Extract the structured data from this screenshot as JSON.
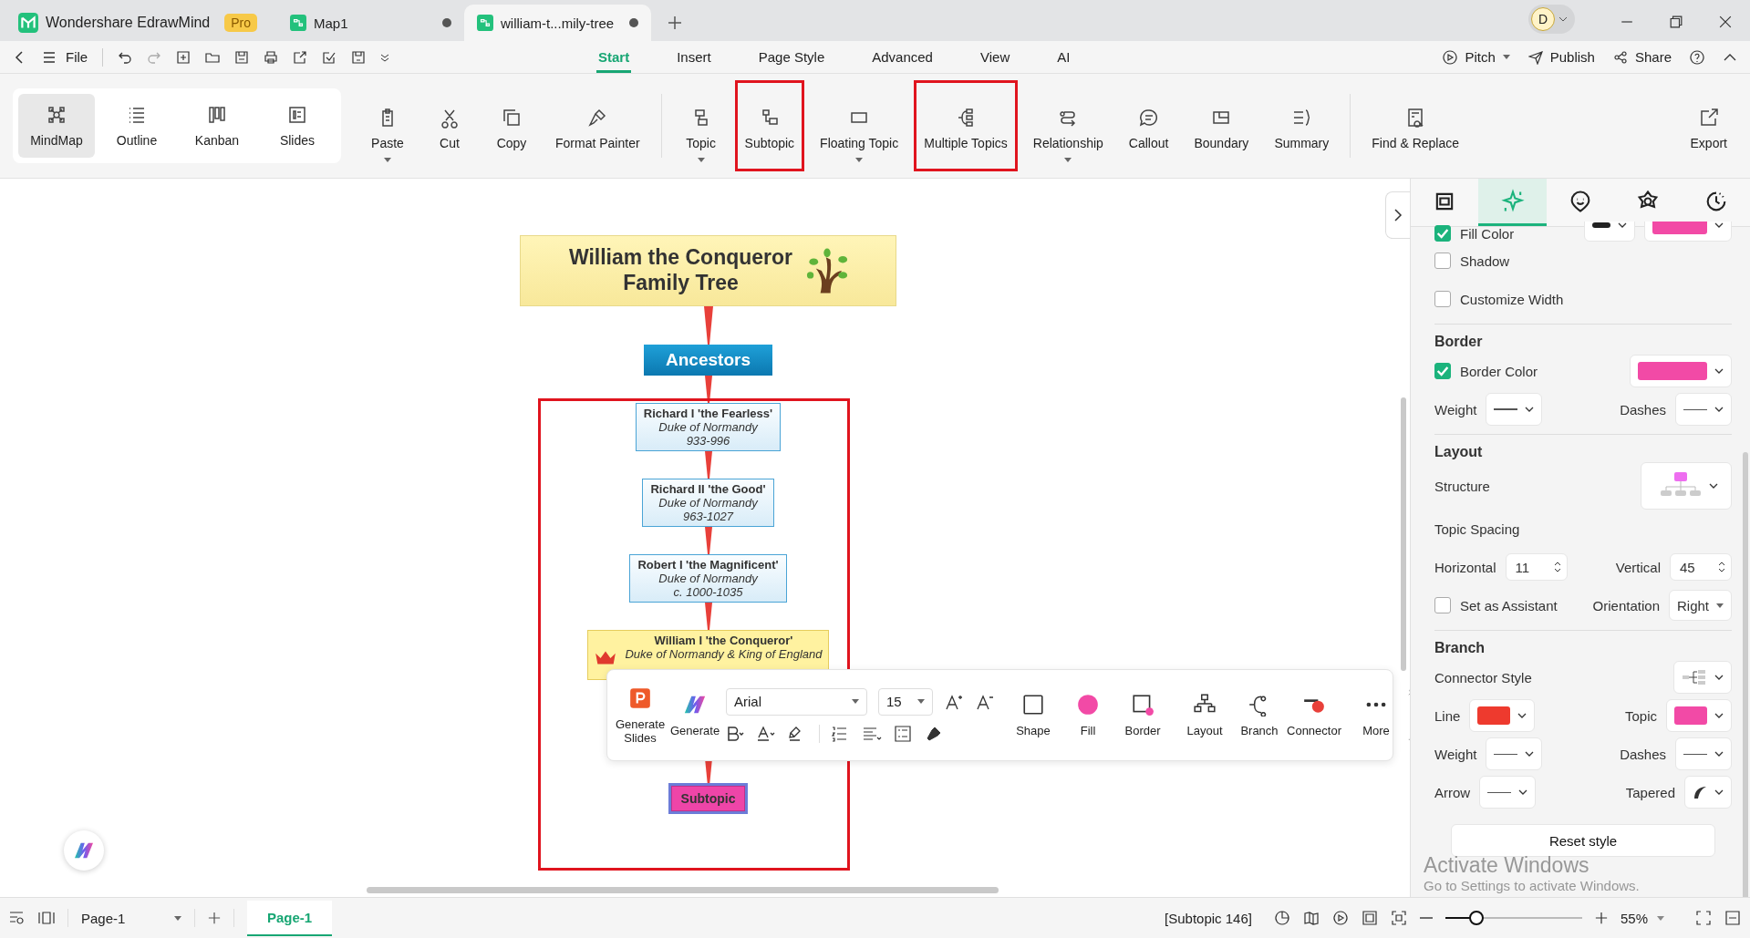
{
  "app": {
    "name": "Wondershare EdrawMind",
    "badge": "Pro"
  },
  "doc_tabs": [
    {
      "label": "Map1",
      "selected": false,
      "unsaved": true
    },
    {
      "label": "william-t...mily-tree",
      "selected": true,
      "unsaved": true
    }
  ],
  "avatar": {
    "initial": "D"
  },
  "menu": {
    "file": "File",
    "tabs": [
      {
        "label": "Start",
        "selected": true
      },
      {
        "label": "Insert",
        "selected": false
      },
      {
        "label": "Page Style",
        "selected": false
      },
      {
        "label": "Advanced",
        "selected": false
      },
      {
        "label": "View",
        "selected": false
      },
      {
        "label": "AI",
        "selected": false
      }
    ],
    "actions": [
      {
        "label": "Pitch",
        "dropdown": true
      },
      {
        "label": "Publish",
        "dropdown": false
      },
      {
        "label": "Share",
        "dropdown": false
      }
    ]
  },
  "ribbon": {
    "views": [
      {
        "label": "MindMap",
        "selected": true
      },
      {
        "label": "Outline",
        "selected": false
      },
      {
        "label": "Kanban",
        "selected": false
      },
      {
        "label": "Slides",
        "selected": false
      }
    ],
    "tool_groups": [
      [
        {
          "label": "Paste",
          "dropdown": true,
          "highlighted": false
        },
        {
          "label": "Cut",
          "dropdown": false,
          "highlighted": false
        },
        {
          "label": "Copy",
          "dropdown": false,
          "highlighted": false
        },
        {
          "label": "Format Painter",
          "dropdown": false,
          "highlighted": false
        }
      ],
      [
        {
          "label": "Topic",
          "dropdown": true,
          "highlighted": false
        },
        {
          "label": "Subtopic",
          "dropdown": false,
          "highlighted": true
        },
        {
          "label": "Floating Topic",
          "dropdown": true,
          "highlighted": false
        },
        {
          "label": "Multiple Topics",
          "dropdown": false,
          "highlighted": true
        },
        {
          "label": "Relationship",
          "dropdown": true,
          "highlighted": false
        },
        {
          "label": "Callout",
          "dropdown": false,
          "highlighted": false
        },
        {
          "label": "Boundary",
          "dropdown": false,
          "highlighted": false
        },
        {
          "label": "Summary",
          "dropdown": false,
          "highlighted": false
        }
      ],
      [
        {
          "label": "Find & Replace",
          "dropdown": false,
          "highlighted": false
        }
      ]
    ],
    "export": "Export"
  },
  "canvas": {
    "title": "William the Conqueror Family Tree",
    "root": "Ancestors",
    "nodes": [
      {
        "kind": "ancestor",
        "name": "Richard I 'the Fearless'",
        "title": "Duke of Normandy",
        "dates": "933-996"
      },
      {
        "kind": "ancestor",
        "name": "Richard II 'the Good'",
        "title": "Duke of Normandy",
        "dates": "963-1027"
      },
      {
        "kind": "ancestor",
        "name": "Robert I 'the Magnificent'",
        "title": "Duke of Normandy",
        "dates": "c. 1000-1035"
      },
      {
        "kind": "king",
        "name": "William I 'the Conqueror'",
        "title": "Duke of Normandy & King of England"
      },
      {
        "kind": "hidden"
      }
    ],
    "selected_node": "Subtopic"
  },
  "format_bar": {
    "generate_slides": "Generate Slides",
    "generate": "Generate",
    "font": "Arial",
    "size": "15",
    "tools": [
      "Shape",
      "Fill",
      "Border"
    ],
    "layout_tools": [
      "Layout",
      "Branch",
      "Connector"
    ],
    "more": "More"
  },
  "panel": {
    "tabs": [
      {
        "selected": false
      },
      {
        "selected": true
      },
      {
        "selected": false
      },
      {
        "selected": false
      },
      {
        "selected": false
      }
    ],
    "fill": {
      "label": "Fill Color",
      "checked": true
    },
    "options": [
      {
        "label": "Shadow",
        "checked": false
      },
      {
        "label": "Customize Width",
        "checked": false
      }
    ],
    "border": {
      "heading": "Border",
      "label": "Border Color",
      "checked": true,
      "weight": "Weight",
      "dashes": "Dashes"
    },
    "layout": {
      "heading": "Layout",
      "structure": "Structure",
      "spacing": "Topic Spacing",
      "horizontal_label": "Horizontal",
      "horizontal": "11",
      "vertical_label": "Vertical",
      "vertical": "45",
      "assistant": {
        "label": "Set as Assistant",
        "checked": false
      },
      "orientation_label": "Orientation",
      "orientation": "Right"
    },
    "branch": {
      "heading": "Branch",
      "connector_style": "Connector Style",
      "line": "Line",
      "topic": "Topic",
      "weight": "Weight",
      "dashes": "Dashes",
      "arrow": "Arrow",
      "tapered": "Tapered"
    },
    "reset": "Reset style"
  },
  "os_notice": {
    "title": "Activate Windows",
    "subtitle": "Go to Settings to activate Windows."
  },
  "status_bar": {
    "page_select": "Page-1",
    "page_tabs": [
      {
        "label": "Page-1",
        "selected": true
      }
    ],
    "selection": "[Subtopic 146]",
    "zoom": {
      "level": 0.22
    },
    "zoom_value": "55%"
  }
}
